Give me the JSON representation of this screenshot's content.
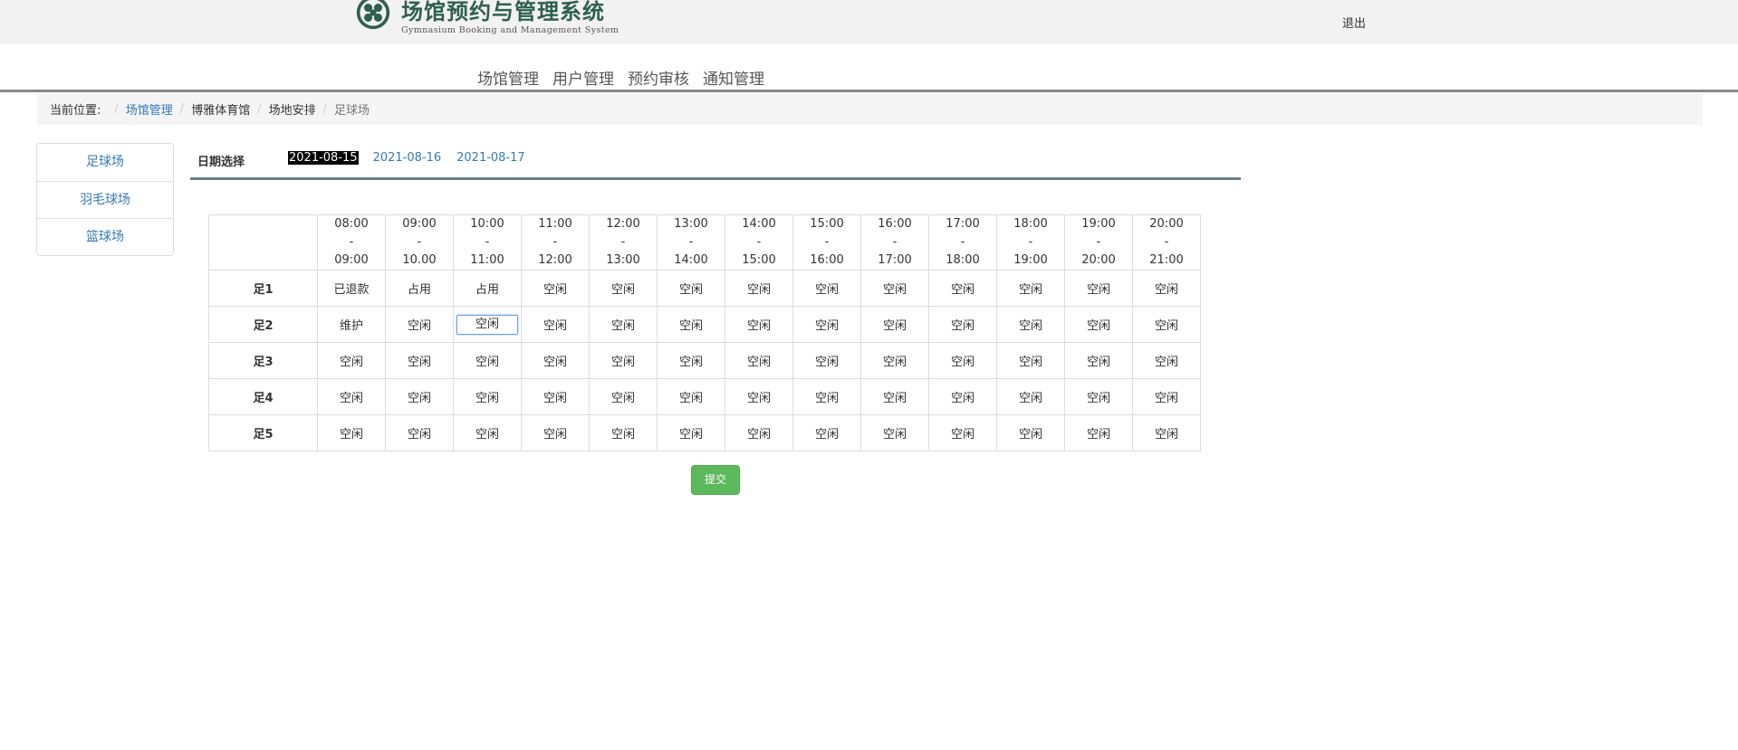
{
  "header": {
    "logo_cn": "场馆预约与管理系统",
    "logo_en": "Gymnasium Booking and Management System",
    "logout_label": "退出"
  },
  "nav": {
    "items": [
      "场馆管理",
      "用户管理",
      "预约审核",
      "通知管理"
    ]
  },
  "breadcrumb": {
    "label": "当前位置:",
    "items": [
      "场馆管理",
      "博雅体育馆",
      "场地安排",
      "足球场"
    ]
  },
  "sidebar": {
    "items": [
      "足球场",
      "羽毛球场",
      "篮球场"
    ]
  },
  "datebar": {
    "label": "日期选择",
    "dates": [
      "2021-08-15",
      "2021-08-16",
      "2021-08-17"
    ],
    "selected": "2021-08-15"
  },
  "schedule": {
    "time_slots": [
      [
        "08:00",
        "09:00"
      ],
      [
        "09:00",
        "10.00"
      ],
      [
        "10:00",
        "11:00"
      ],
      [
        "11:00",
        "12:00"
      ],
      [
        "12:00",
        "13:00"
      ],
      [
        "13:00",
        "14:00"
      ],
      [
        "14:00",
        "15:00"
      ],
      [
        "15:00",
        "16:00"
      ],
      [
        "16:00",
        "17:00"
      ],
      [
        "17:00",
        "18:00"
      ],
      [
        "18:00",
        "19:00"
      ],
      [
        "19:00",
        "20:00"
      ],
      [
        "20:00",
        "21:00"
      ]
    ],
    "dash": "-",
    "courts": [
      {
        "name": "足1",
        "slots": [
          "已退款",
          "占用",
          "占用",
          "空闲",
          "空闲",
          "空闲",
          "空闲",
          "空闲",
          "空闲",
          "空闲",
          "空闲",
          "空闲",
          "空闲"
        ]
      },
      {
        "name": "足2",
        "slots": [
          "维护",
          "空闲",
          "空闲",
          "空闲",
          "空闲",
          "空闲",
          "空闲",
          "空闲",
          "空闲",
          "空闲",
          "空闲",
          "空闲",
          "空闲"
        ]
      },
      {
        "name": "足3",
        "slots": [
          "空闲",
          "空闲",
          "空闲",
          "空闲",
          "空闲",
          "空闲",
          "空闲",
          "空闲",
          "空闲",
          "空闲",
          "空闲",
          "空闲",
          "空闲"
        ]
      },
      {
        "name": "足4",
        "slots": [
          "空闲",
          "空闲",
          "空闲",
          "空闲",
          "空闲",
          "空闲",
          "空闲",
          "空闲",
          "空闲",
          "空闲",
          "空闲",
          "空闲",
          "空闲"
        ]
      },
      {
        "name": "足5",
        "slots": [
          "空闲",
          "空闲",
          "空闲",
          "空闲",
          "空闲",
          "空闲",
          "空闲",
          "空闲",
          "空闲",
          "空闲",
          "空闲",
          "空闲",
          "空闲"
        ]
      }
    ]
  },
  "submit_label": "提交",
  "colors": {
    "link": "#337ab7",
    "submit": "#5cb85c",
    "logo": "#2e5f4f",
    "nav_underline": "#888888"
  }
}
